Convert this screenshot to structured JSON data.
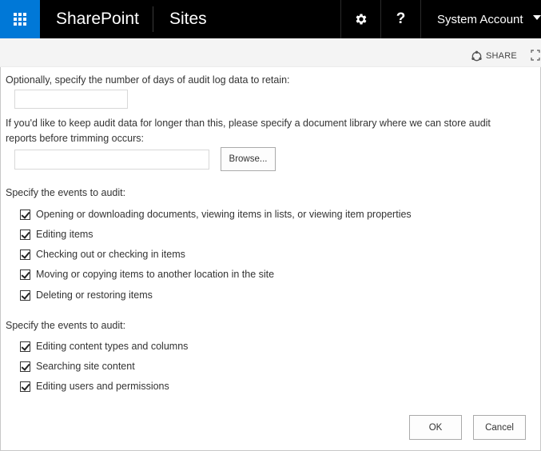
{
  "suite_bar": {
    "brand": "SharePoint",
    "nav_link": "Sites",
    "help_label": "?",
    "account_name": "System Account",
    "accent_color": "#0078d7",
    "waffle_icon": "app-launcher-icon",
    "settings_icon": "gear-icon"
  },
  "ribbon": {
    "share_label": "SHARE",
    "share_icon": "share-icon",
    "focus_icon": "focus-on-content-icon"
  },
  "form": {
    "retain_label": "Optionally, specify the number of days of audit log data to retain:",
    "retain_days_value": "",
    "library_label": "If you'd like to keep audit data for longer than this, please specify a document library where we can store audit reports before trimming occurs:",
    "library_value": "",
    "browse_label": "Browse...",
    "events_section_1_label": "Specify the events to audit:",
    "events_section_1": [
      {
        "label": "Opening or downloading documents, viewing items in lists, or viewing item properties",
        "checked": true
      },
      {
        "label": "Editing items",
        "checked": true
      },
      {
        "label": "Checking out or checking in items",
        "checked": true
      },
      {
        "label": "Moving or copying items to another location in the site",
        "checked": true
      },
      {
        "label": "Deleting or restoring items",
        "checked": true
      }
    ],
    "events_section_2_label": "Specify the events to audit:",
    "events_section_2": [
      {
        "label": "Editing content types and columns",
        "checked": true
      },
      {
        "label": "Searching site content",
        "checked": true
      },
      {
        "label": "Editing users and permissions",
        "checked": true
      }
    ],
    "ok_label": "OK",
    "cancel_label": "Cancel"
  }
}
